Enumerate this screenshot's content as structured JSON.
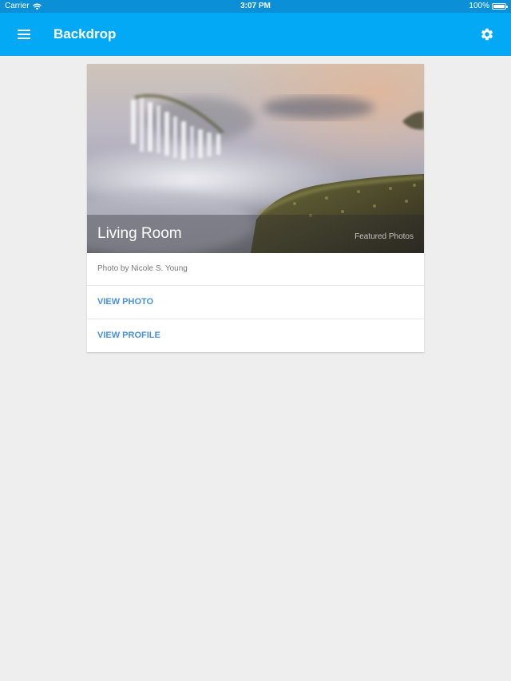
{
  "status_bar": {
    "carrier": "Carrier",
    "time": "3:07 PM",
    "battery": "100%"
  },
  "app_bar": {
    "title": "Backdrop",
    "menu_icon": "hamburger-menu-icon",
    "settings_icon": "gear-icon"
  },
  "card": {
    "title": "Living Room",
    "source": "Featured Photos",
    "caption": "Photo by Nicole S. Young",
    "actions": [
      {
        "label": "VIEW PHOTO"
      },
      {
        "label": "VIEW PROFILE"
      }
    ]
  },
  "colors": {
    "status_bar": "#0b8fd6",
    "app_bar": "#03a9f4",
    "background": "#eeeeee",
    "action_text": "#4a90d9"
  }
}
